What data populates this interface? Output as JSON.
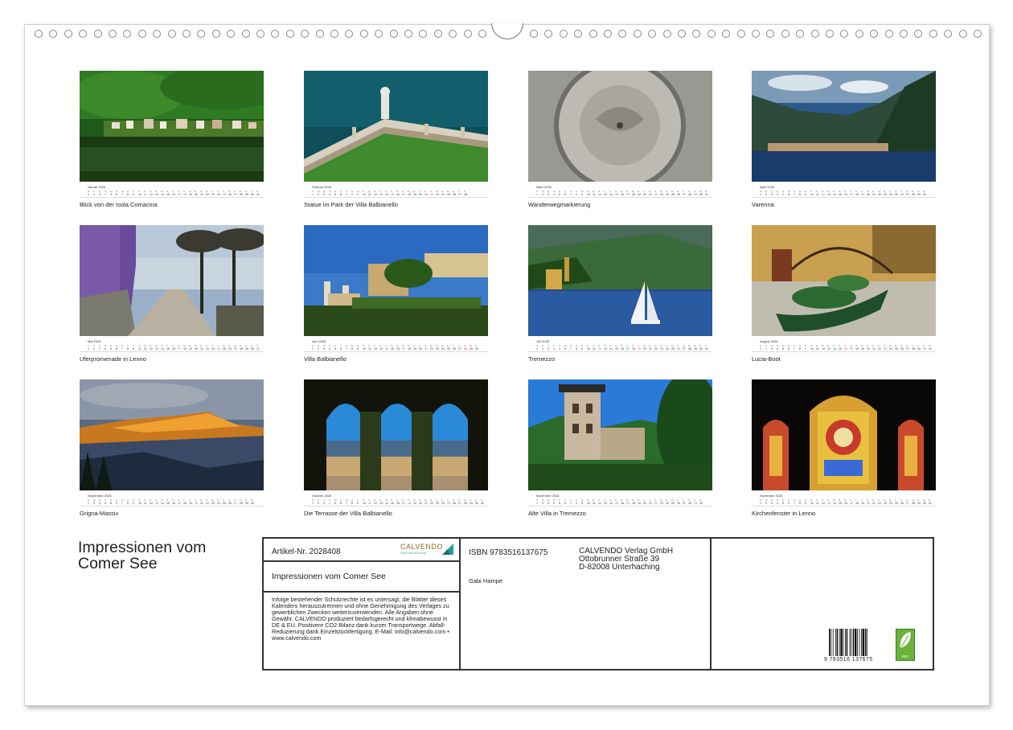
{
  "calendar": {
    "weekdays": [
      "M",
      "D",
      "M",
      "D",
      "F",
      "S",
      "S"
    ],
    "months": [
      {
        "name": "Januar 2026",
        "caption": "Blick von der Isola Comacina",
        "days": 31,
        "start": 3,
        "icon": "lake-village-photo"
      },
      {
        "name": "Februar 2026",
        "caption": "Statue im Park der Villa Balbianello",
        "days": 28,
        "start": 6,
        "icon": "terrace-statue-photo"
      },
      {
        "name": "März 2026",
        "caption": "Wanderwegmarkierung",
        "days": 31,
        "start": 6,
        "icon": "trail-marker-photo"
      },
      {
        "name": "April 2026",
        "caption": "Varenna",
        "days": 30,
        "start": 2,
        "icon": "varenna-photo"
      },
      {
        "name": "Mai 2026",
        "caption": "Uferpromenade in Lenno",
        "days": 31,
        "start": 4,
        "icon": "promenade-photo"
      },
      {
        "name": "Juni 2026",
        "caption": "Villa Balbianello",
        "days": 30,
        "start": 0,
        "icon": "villa-photo"
      },
      {
        "name": "Juli 2026",
        "caption": "Tremezzo",
        "days": 31,
        "start": 2,
        "icon": "sailboat-photo"
      },
      {
        "name": "August 2026",
        "caption": "Lucia-Boot",
        "days": 31,
        "start": 5,
        "icon": "boat-photo"
      },
      {
        "name": "September 2026",
        "caption": "Grigna-Massiv",
        "days": 30,
        "start": 1,
        "icon": "mountain-photo"
      },
      {
        "name": "Oktober 2026",
        "caption": "Die Terrasse der Villa Balbianello",
        "days": 31,
        "start": 3,
        "icon": "arches-photo"
      },
      {
        "name": "November 2026",
        "caption": "Alte Villa in Tremezzo",
        "days": 30,
        "start": 6,
        "icon": "old-villa-photo"
      },
      {
        "name": "Dezember 2026",
        "caption": "Kirchenfenster in Lenno",
        "days": 31,
        "start": 1,
        "icon": "stained-glass-photo"
      }
    ]
  },
  "cover": {
    "title_line1": "Impressionen vom",
    "title_line2": "Comer See"
  },
  "info": {
    "artikel": "Artikel-Nr. 2028408",
    "brand": "CALVENDO",
    "brand_sub": "Dein Kalenderverlag",
    "title": "Impressionen vom Comer See",
    "legal": "Infolge bestehender Schutzrechte ist es untersagt, die Blätter dieses Kalenders herauszutrennen und ohne Genehmigung des Verlages zu gewerblichen Zwecken weiterzuverwenden. Alle Angaben ohne Gewähr. CALVENDO produziert bedarfsgerecht und klimabewusst in DE & EU. Positivere CO2-Bilanz dank kurzer Transportwege. Abfall-Reduzierung dank Einzelstückfertigung. E-Mail: info@calvendo.com • www.calvendo.com",
    "isbn": "ISBN 9783516137675",
    "author": "Gabi Hampe",
    "publisher_line1": "CALVENDO Verlag GmbH",
    "publisher_line2": "Ottobrunner Straße 39",
    "publisher_line3": "D-82008 Unterhaching",
    "barcode_number": "9 783516 137675",
    "eco_label": "eco",
    "colors": {
      "brand_gold": "#8a6a2a",
      "brand_teal": "#2a9d9a",
      "eco_green": "#6ab23a"
    }
  }
}
